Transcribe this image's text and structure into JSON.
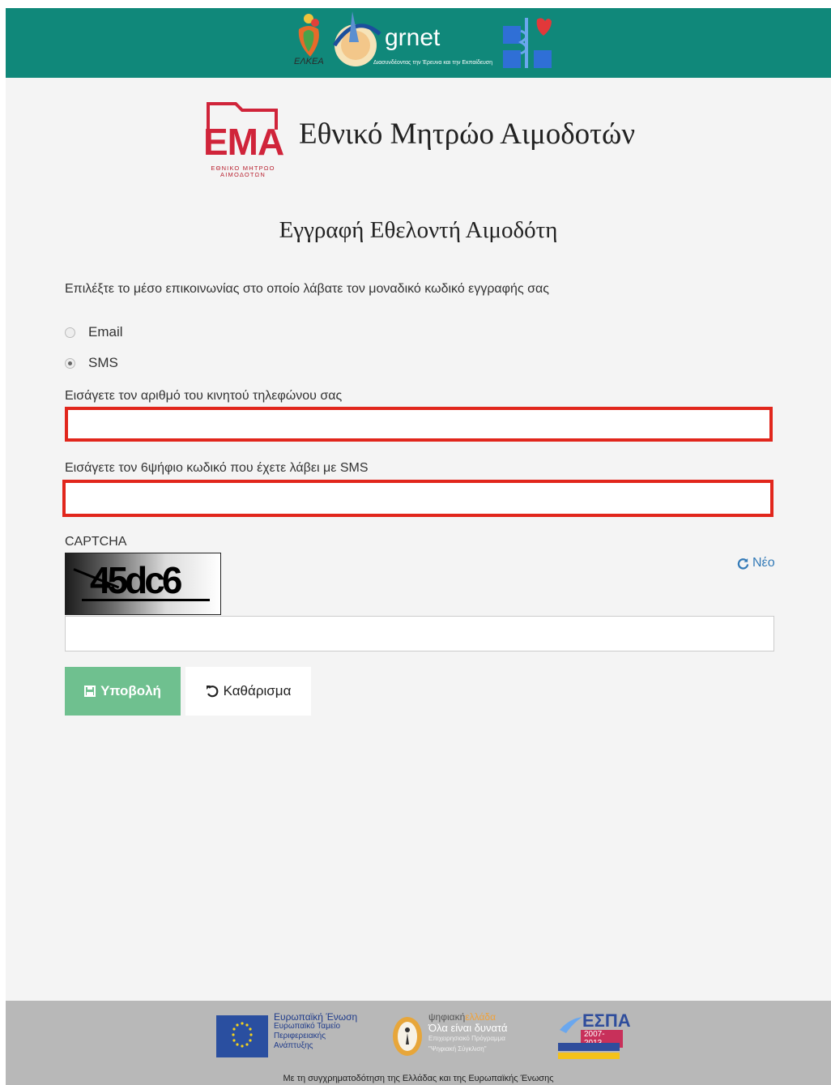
{
  "header": {
    "partner1": {
      "name": "ΕΛΚΕΑ",
      "icon": "elkea-logo"
    },
    "partner2": {
      "name": "grnet",
      "tagline": "Διασυνδέοντας την Έρευνα και την Εκπαίδευση",
      "icon": "grnet-logo"
    },
    "partner3": {
      "icon": "medical-caduceus-logo"
    },
    "accent_color": "#10887a"
  },
  "brand": {
    "logo_word": "ΕΜΑ",
    "logo_line1": "ΕΘΝΙΚΟ ΜΗΤΡΩΟ",
    "logo_line2": "ΑΙΜΟΔΟΤΩΝ",
    "title": "Εθνικό Μητρώο Αιμοδοτών",
    "brand_color": "#d0243a"
  },
  "form": {
    "heading": "Εγγραφή Εθελοντή Αιμοδότη",
    "channel_prompt": "Επιλέξτε το μέσο επικοινωνίας στο οποίο λάβατε τον μοναδικό κωδικό εγγραφής σας",
    "options": [
      {
        "label": "Email",
        "selected": false
      },
      {
        "label": "SMS",
        "selected": true
      }
    ],
    "phone_label": "Εισάγετε τον αριθμό του κινητού τηλεφώνου σας",
    "phone_value": "",
    "code_label": "Εισάγετε τον 6ψήφιο κωδικό που έχετε λάβει με SMS",
    "code_value": "",
    "captcha_label": "CAPTCHA",
    "captcha_text": "45dc6",
    "captcha_refresh": "Νέο",
    "captcha_value": "",
    "submit_label": "Υποβολή",
    "clear_label": "Καθάρισμα",
    "submit_color": "#6fc08f",
    "error_border_color": "#e1261c"
  },
  "footer": {
    "eu_line1": "Ευρωπαϊκή Ένωση",
    "eu_line2": "Ευρωπαϊκό Ταμείο",
    "eu_line3": "Περιφερειακής",
    "eu_line4": "Ανάπτυξης",
    "digital_line1": "ψηφιακή",
    "digital_line1b": "ελλάδα",
    "digital_line2": "Όλα είναι δυνατά",
    "digital_line3": "Επιχειρησιακό Πρόγραμμα",
    "digital_line4": "\"Ψηφιακή Σύγκλιση\"",
    "espa_word": "ΕΣΠΑ",
    "espa_years": "2007-2013",
    "caption": "Με τη συγχρηματοδότηση της Ελλάδας και της Ευρωπαϊκής Ένωσης"
  }
}
